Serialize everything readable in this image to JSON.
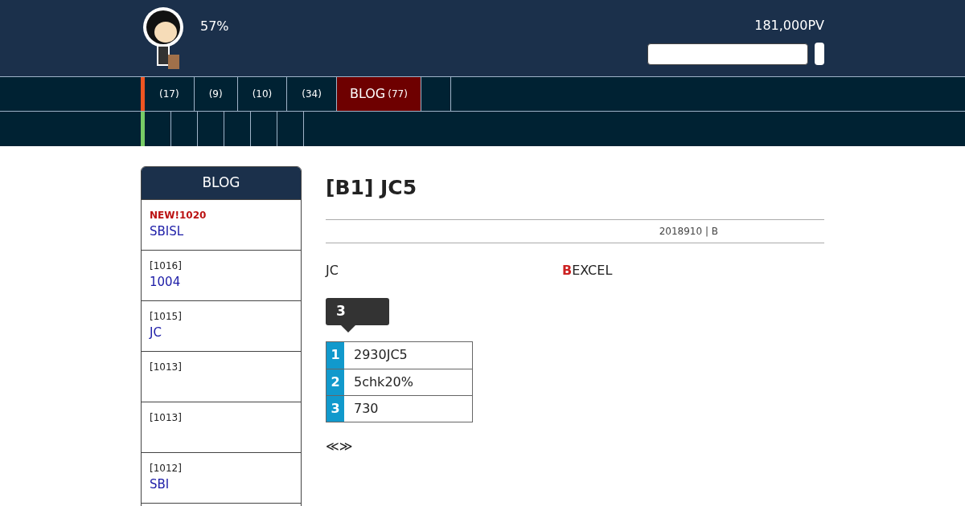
{
  "header": {
    "percent": "57%",
    "pageviews": "181,000PV"
  },
  "nav": [
    {
      "count": "(17)",
      "selected": false
    },
    {
      "count": "(9)",
      "selected": false
    },
    {
      "count": "(10)",
      "selected": false
    },
    {
      "count": "(34)",
      "selected": false
    },
    {
      "label": "BLOG",
      "count": "(77)",
      "selected": true
    },
    {
      "selected": false
    }
  ],
  "sidebar": {
    "title": "BLOG",
    "items": [
      {
        "new": true,
        "tag": "NEW!1020",
        "title": "SBISL"
      },
      {
        "new": false,
        "tag": "[1016]",
        "title": "1004"
      },
      {
        "new": false,
        "tag": "[1015]",
        "title": "JC"
      },
      {
        "new": false,
        "tag": "[1013]"
      },
      {
        "new": false,
        "tag": "[1013]"
      },
      {
        "new": false,
        "tag": "[1012]",
        "title": "SBI"
      }
    ]
  },
  "article": {
    "title": "[B1] JC5",
    "meta": "2018910 | B",
    "intro_left": "JC",
    "intro_right": "**B**EXCEL",
    "callout": "3",
    "list": [
      {
        "number": "1",
        "text": "2930JC5"
      },
      {
        "number": "2",
        "text": "5chk20%"
      },
      {
        "number": "3",
        "text": "730"
      }
    ],
    "pager": "≪≫"
  }
}
